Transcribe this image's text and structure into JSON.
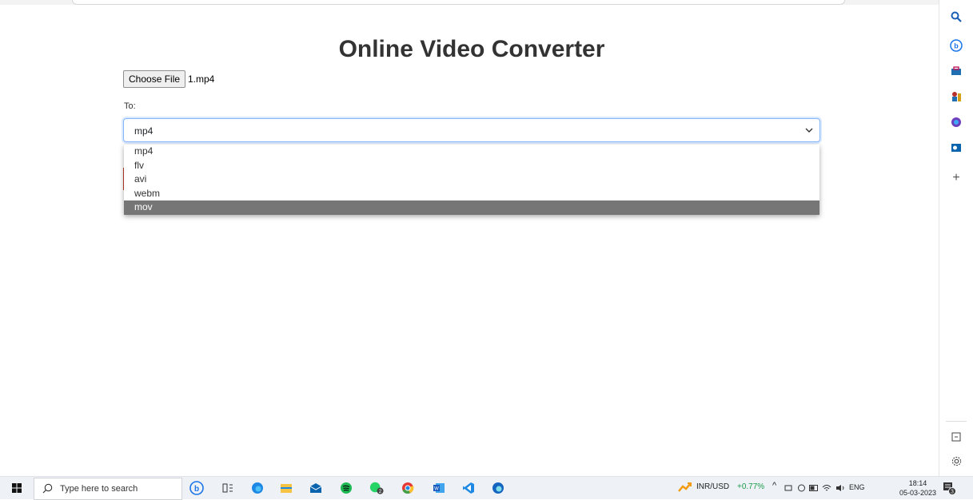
{
  "page": {
    "title": "Online Video Converter",
    "choose_file_label": "Choose File",
    "file_name": "1.mp4",
    "to_label": "To:",
    "selected_format": "mp4",
    "format_options": [
      "mp4",
      "flv",
      "avi",
      "webm",
      "mov"
    ],
    "highlighted_option": "mov"
  },
  "taskbar": {
    "search_placeholder": "Type here to search",
    "whatsapp_badge": "2",
    "stock_ticker": "INR/USD",
    "stock_change": "+0.77%",
    "language": "ENG",
    "time": "18:14",
    "date": "05-03-2023",
    "notification_count": "3"
  },
  "colors": {
    "accent_focus": "#86b7fe",
    "highlight_bg": "#767676",
    "stock_positive": "#1a9a4a"
  }
}
